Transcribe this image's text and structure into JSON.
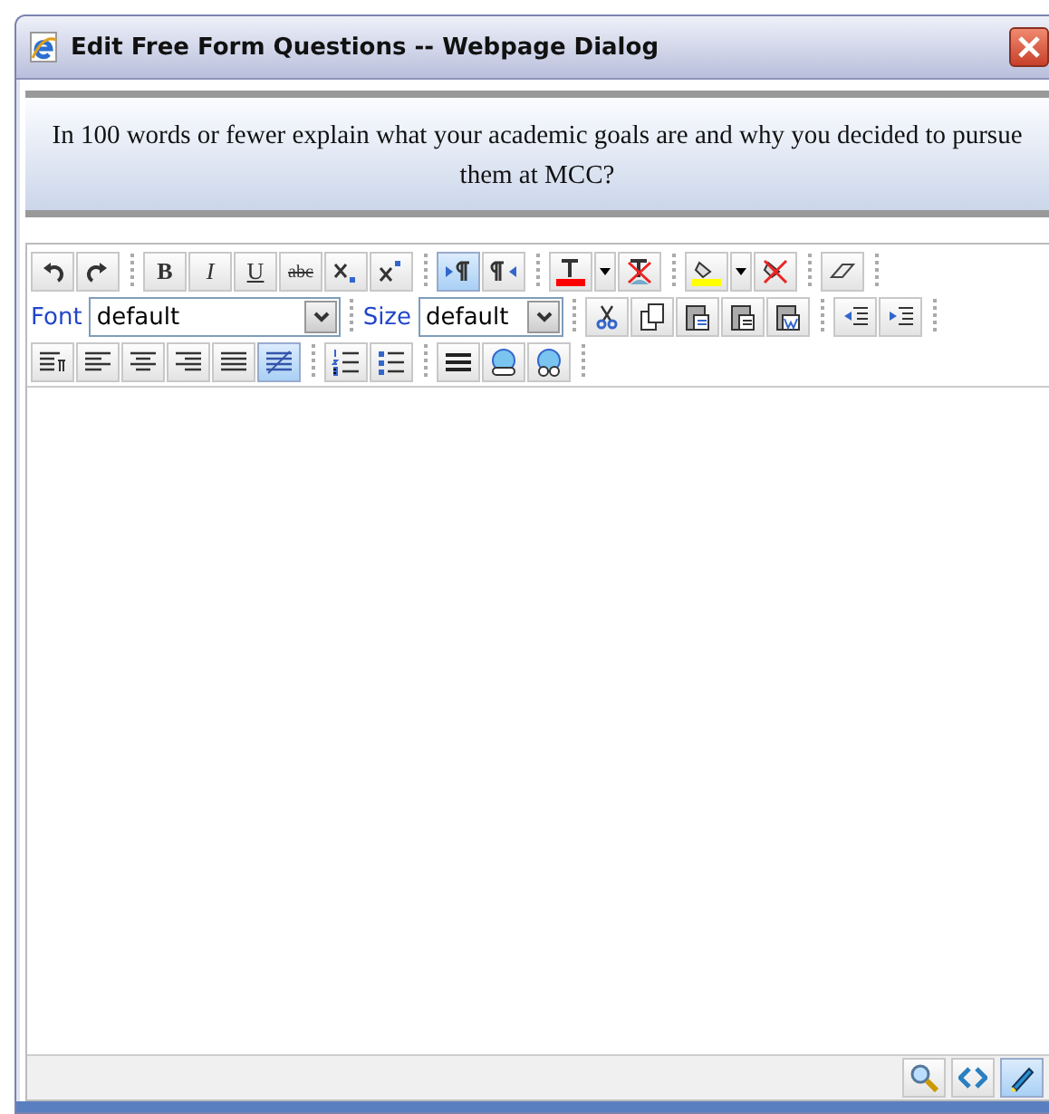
{
  "window": {
    "title": "Edit Free Form Questions -- Webpage Dialog"
  },
  "question": "In 100 words or fewer explain what your academic goals are and why you decided to pursue them at MCC?",
  "toolbar_rows": [
    [
      [
        {
          "kind": "button",
          "selected": false
        },
        {
          "kind": "button",
          "selected": false
        }
      ],
      [
        {
          "kind": "button",
          "text": "B",
          "selected": false
        },
        {
          "kind": "button",
          "text": "I",
          "selected": false
        },
        {
          "kind": "button",
          "text": "U",
          "selected": false
        },
        {
          "kind": "button",
          "text": "abc",
          "selected": false
        },
        {
          "kind": "button",
          "selected": false
        },
        {
          "kind": "button",
          "selected": false
        }
      ],
      [
        {
          "kind": "button",
          "selected": true
        },
        {
          "kind": "button",
          "selected": false
        }
      ],
      [
        {
          "kind": "button",
          "selected": false
        },
        {
          "kind": "dropdown"
        },
        {
          "kind": "button",
          "selected": false
        }
      ],
      [
        {
          "kind": "button",
          "selected": false
        },
        {
          "kind": "dropdown"
        },
        {
          "kind": "button",
          "selected": false
        }
      ],
      [
        {
          "kind": "button",
          "selected": false
        }
      ]
    ],
    [
      [
        {
          "kind": "select",
          "label": "Font",
          "value": "default"
        }
      ],
      [
        {
          "kind": "select",
          "label": "Size",
          "value": "default"
        }
      ],
      [
        {
          "kind": "button",
          "selected": false
        },
        {
          "kind": "button",
          "selected": false
        },
        {
          "kind": "button",
          "selected": false
        },
        {
          "kind": "button",
          "selected": false
        },
        {
          "kind": "button",
          "selected": false
        }
      ],
      [
        {
          "kind": "button",
          "selected": false
        },
        {
          "kind": "button",
          "selected": false
        }
      ]
    ],
    [
      [
        {
          "kind": "button",
          "selected": false
        },
        {
          "kind": "button",
          "selected": false
        },
        {
          "kind": "button",
          "selected": false
        },
        {
          "kind": "button",
          "selected": false
        },
        {
          "kind": "button",
          "selected": false
        },
        {
          "kind": "button",
          "selected": true
        }
      ],
      [
        {
          "kind": "button",
          "selected": false
        },
        {
          "kind": "button",
          "selected": false
        }
      ],
      [
        {
          "kind": "button",
          "selected": false
        },
        {
          "kind": "button",
          "selected": false
        },
        {
          "kind": "button",
          "selected": false
        }
      ]
    ]
  ],
  "mode_buttons": [
    {
      "selected": false
    },
    {
      "selected": false
    },
    {
      "selected": true
    }
  ]
}
